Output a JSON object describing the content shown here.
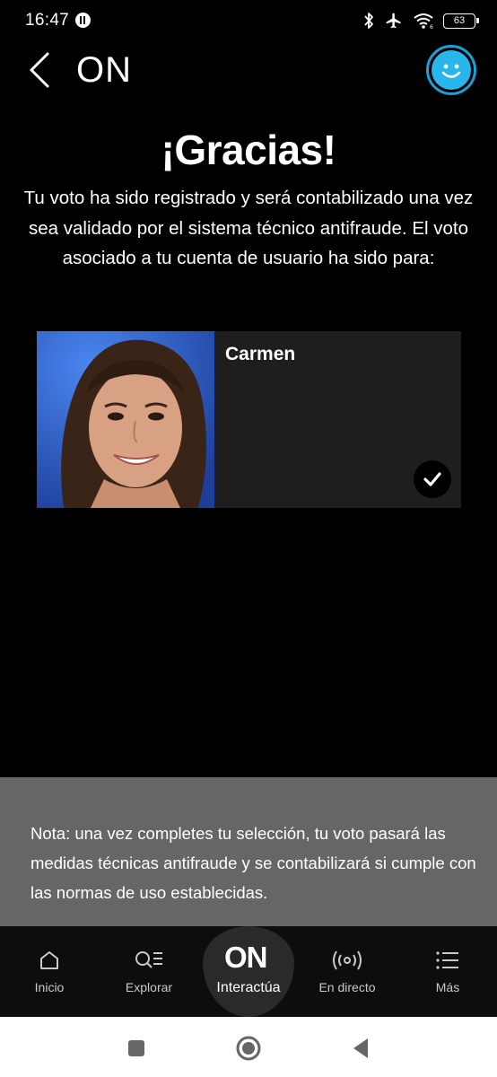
{
  "status_bar": {
    "time": "16:47",
    "battery": "63"
  },
  "header": {
    "title": "ON",
    "back_icon": "chevron-left-icon",
    "avatar_icon": "smiley-avatar-icon",
    "accent_color": "#29b6ea"
  },
  "confirmation": {
    "title": "¡Gracias!",
    "message": "Tu voto ha sido registrado y será contabilizado una vez sea validado por el sistema técnico antifraude. El voto asociado a tu cuenta de usuario ha sido para:"
  },
  "candidate": {
    "name": "Carmen",
    "selected": true
  },
  "note": {
    "text": "Nota: una vez completes tu selección, tu voto pasará las medidas técnicas antifraude y se contabilizará si cumple con las normas de uso establecidas."
  },
  "bottom_nav": {
    "items": [
      {
        "label": "Inicio",
        "icon": "home-icon"
      },
      {
        "label": "Explorar",
        "icon": "explore-icon"
      },
      {
        "label": "Interactúa",
        "icon": "on-logo-icon",
        "logo": "ON",
        "active": true
      },
      {
        "label": "En directo",
        "icon": "broadcast-icon"
      },
      {
        "label": "Más",
        "icon": "menu-icon"
      }
    ]
  },
  "system_nav": {
    "buttons": [
      "recents-button",
      "home-button",
      "back-button"
    ]
  }
}
